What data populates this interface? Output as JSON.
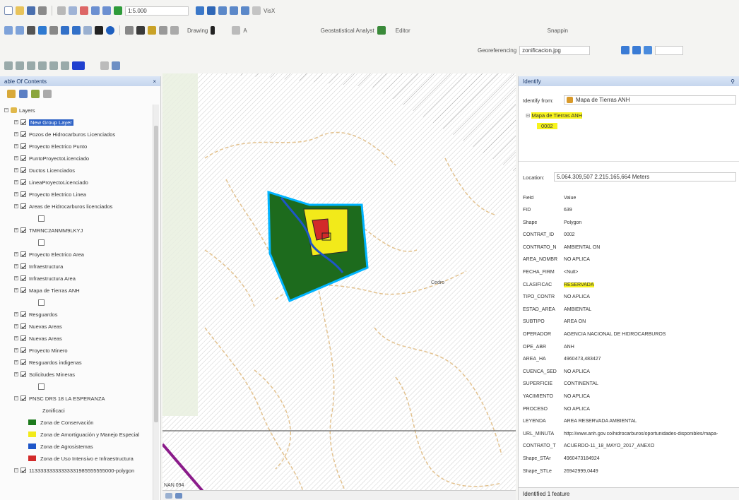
{
  "toolbars": {
    "scale_value": "1:5.000",
    "drawing_label": "Drawing",
    "geostatistical_label": "Geostatistical Analyst",
    "editor_label": "Editor",
    "snapping_label": "Snappin",
    "georeferencing_label": "Georeferencing",
    "georef_layer": "zonificacion.jpg",
    "title_fragment": "VisX"
  },
  "toc": {
    "title": "able Of Contents",
    "close": "× ",
    "layers_root": "Layers",
    "layers": [
      {
        "label": "New Group Layer",
        "selected": true
      },
      {
        "label": "Pozos de Hidrocarburos Licenciados"
      },
      {
        "label": "Proyecto Electrico Punto"
      },
      {
        "label": "PuntoProyectoLicenciado"
      },
      {
        "label": "Ductos Licenciados"
      },
      {
        "label": "LineaProyectoLicenciado"
      },
      {
        "label": "Proyecto Electrico Linea"
      },
      {
        "label": "Areas de Hidrocarburos licenciados"
      },
      {
        "label": "TMRNC2ANMM9LKYJ"
      },
      {
        "label": "Proyecto Electrico Area"
      },
      {
        "label": "Infraestructura"
      },
      {
        "label": "Infraestructura Area"
      },
      {
        "label": "Mapa de Tierras ANH"
      },
      {
        "label": "Resguardos"
      },
      {
        "label": "Nuevas Areas"
      },
      {
        "label": "Nuevas Areas"
      },
      {
        "label": "Proyecto Minero"
      },
      {
        "label": "Resguardos indigenas"
      },
      {
        "label": "Solicitudes Mineras"
      }
    ],
    "pnsc_layer": "PNSC DRS 18 LA ESPERANZA",
    "zonificac": "Zonificaci",
    "legend": [
      {
        "label": "Zona de Conservación",
        "color": "#1d7a1d"
      },
      {
        "label": "Zona de Amortiguación y Manejo Especial",
        "color": "#f2ea1a"
      },
      {
        "label": "Zona de Agrosistemas",
        "color": "#1e56c8"
      },
      {
        "label": "Zona de Uso Intensivo e Infraestructura",
        "color": "#d22a2a"
      }
    ],
    "polygon_layer": "11333333333333331985555555000-polygon"
  },
  "map": {
    "label_cedro": "Cedro",
    "label_bottom": "NAN 094"
  },
  "identify": {
    "title": "Identify",
    "identify_from_label": "Identify from:",
    "identify_from_value": "Mapa de Tierras ANH",
    "tree_parent": "Mapa de Tierras ANH",
    "tree_child": "0002",
    "location_label": "Location:",
    "location_value": "5.064.309,507  2.215.165,664 Meters",
    "field_header": "Field",
    "value_header": "Value",
    "attributes": [
      {
        "field": "FID",
        "value": "639"
      },
      {
        "field": "Shape",
        "value": "Polygon"
      },
      {
        "field": "CONTRAT_ID",
        "value": "0002"
      },
      {
        "field": "CONTRATO_N",
        "value": "AMBIENTAL ON"
      },
      {
        "field": "AREA_NOMBR",
        "value": "NO APLICA"
      },
      {
        "field": "FECHA_FIRM",
        "value": "<Null>"
      },
      {
        "field": "CLASIFICAC",
        "value": "RESERVADA",
        "highlight": true
      },
      {
        "field": "TIPO_CONTR",
        "value": "NO APLICA"
      },
      {
        "field": "ESTAD_AREA",
        "value": "AMBIENTAL"
      },
      {
        "field": "SUBTIPO",
        "value": "AREA ON"
      },
      {
        "field": "OPERADOR",
        "value": "AGENCIA NACIONAL DE HIDROCARBUROS"
      },
      {
        "field": "OPE_ABR",
        "value": "ANH"
      },
      {
        "field": "AREA_HA",
        "value": "4960473,483427"
      },
      {
        "field": "CUENCA_SED",
        "value": "NO APLICA"
      },
      {
        "field": "SUPERFICIE",
        "value": "CONTINENTAL"
      },
      {
        "field": "YACIMIENTO",
        "value": "NO APLICA"
      },
      {
        "field": "PROCESO",
        "value": "NO APLICA"
      },
      {
        "field": "LEYENDA",
        "value": "AREA RESERVADA AMBIENTAL"
      },
      {
        "field": "URL_MINUTA",
        "value": "http://www.anh.gov.co/hidrocarburos/oportunidades-disponibles/mapa-"
      },
      {
        "field": "CONTRATO_T",
        "value": "ACUERDO-11_18_MAYO_2017_ANEXO"
      },
      {
        "field": "Shape_STAr",
        "value": "4960473184924"
      },
      {
        "field": "Shape_STLe",
        "value": "26942999,0449"
      }
    ],
    "status": "Identified 1 feature"
  },
  "colors": {
    "conservation": "#1d6b1d",
    "amortiguacion": "#f2ea1a",
    "agrosistemas": "#1e56c8",
    "uso_intensivo": "#d22a2a",
    "selection_outline": "#00b4ff",
    "contour": "#e3c28f",
    "highlight": "#f7f31d"
  }
}
